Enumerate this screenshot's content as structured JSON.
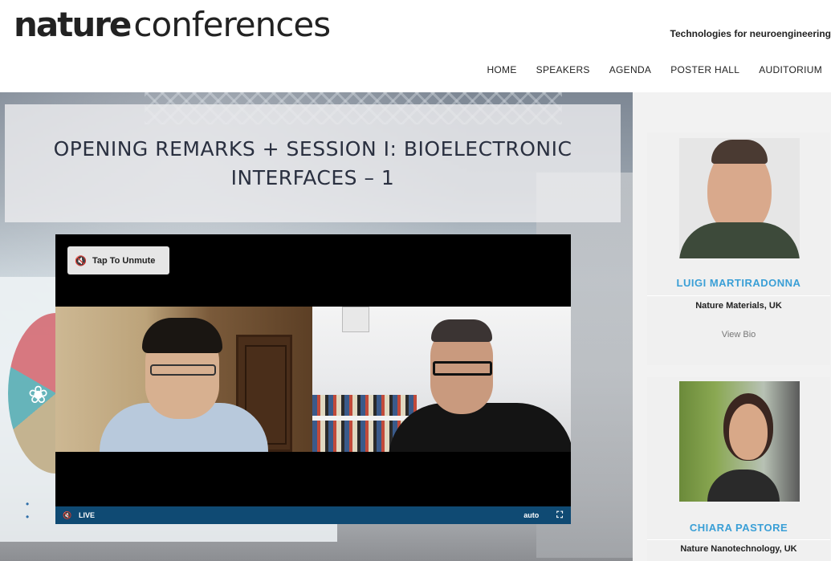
{
  "header": {
    "logo_bold": "nature",
    "logo_light": "conferences",
    "conference_title": "Technologies for neuroengineering",
    "nav": [
      "HOME",
      "SPEAKERS",
      "AGENDA",
      "POSTER HALL",
      "AUDITORIUM"
    ]
  },
  "session": {
    "title": "OPENING REMARKS + SESSION I: BIOELECTRONIC INTERFACES – 1"
  },
  "player": {
    "unmute_label": "Tap To Unmute",
    "live_label": "LIVE",
    "quality_label": "auto"
  },
  "speakers": [
    {
      "name": "LUIGI MARTIRADONNA",
      "affiliation": "Nature Materials, UK",
      "bio_link": "View Bio"
    },
    {
      "name": "CHIARA PASTORE",
      "affiliation": "Nature Nanotechnology, UK"
    }
  ],
  "colors": {
    "accent": "#3a9fd6",
    "player_bar": "#0f4a73",
    "sidebar_bg": "#f2f2f2"
  }
}
